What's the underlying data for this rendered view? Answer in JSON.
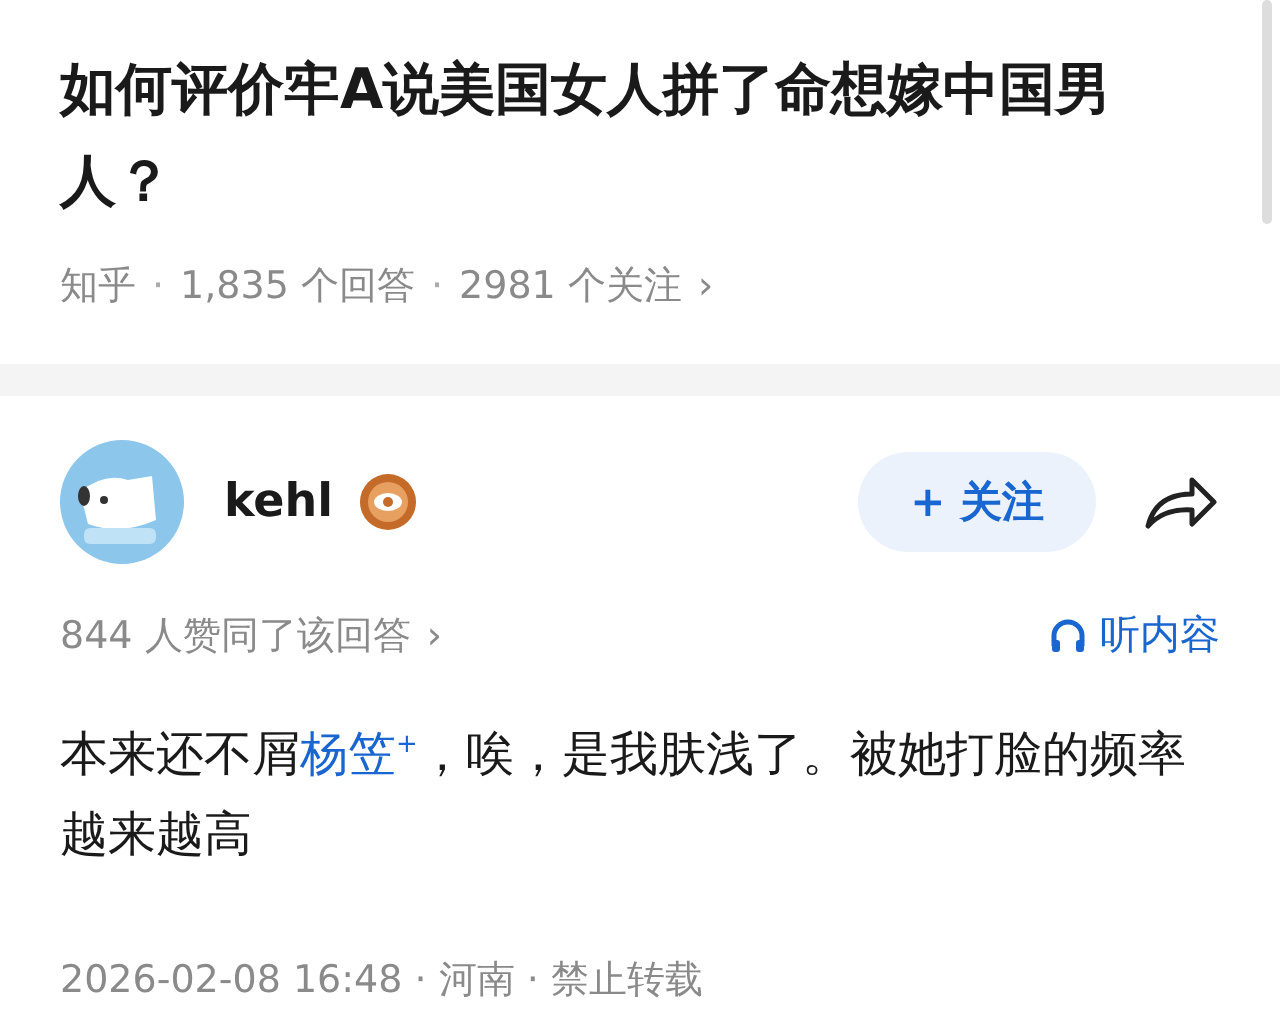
{
  "question": {
    "title": "如何评价牢A说美国女人拼了命想嫁中国男人？",
    "meta": [
      "知乎",
      "1,835 个回答",
      "2981 个关注"
    ],
    "meta_chevron": "›",
    "meta_separator": "·"
  },
  "answer": {
    "author": "kehl",
    "follow_button": "+ 关注",
    "votes": "844 人赞同了该回答",
    "votes_chevron": "›",
    "listen": "听内容",
    "body": {
      "before": "本来还不屑",
      "link": "杨笠",
      "link_mark": "+",
      "after": "，唉，是我肤浅了。被她打脸的频率越来越高"
    },
    "footer": "2026-02-08 16:48 · 河南 · 禁止转载"
  }
}
